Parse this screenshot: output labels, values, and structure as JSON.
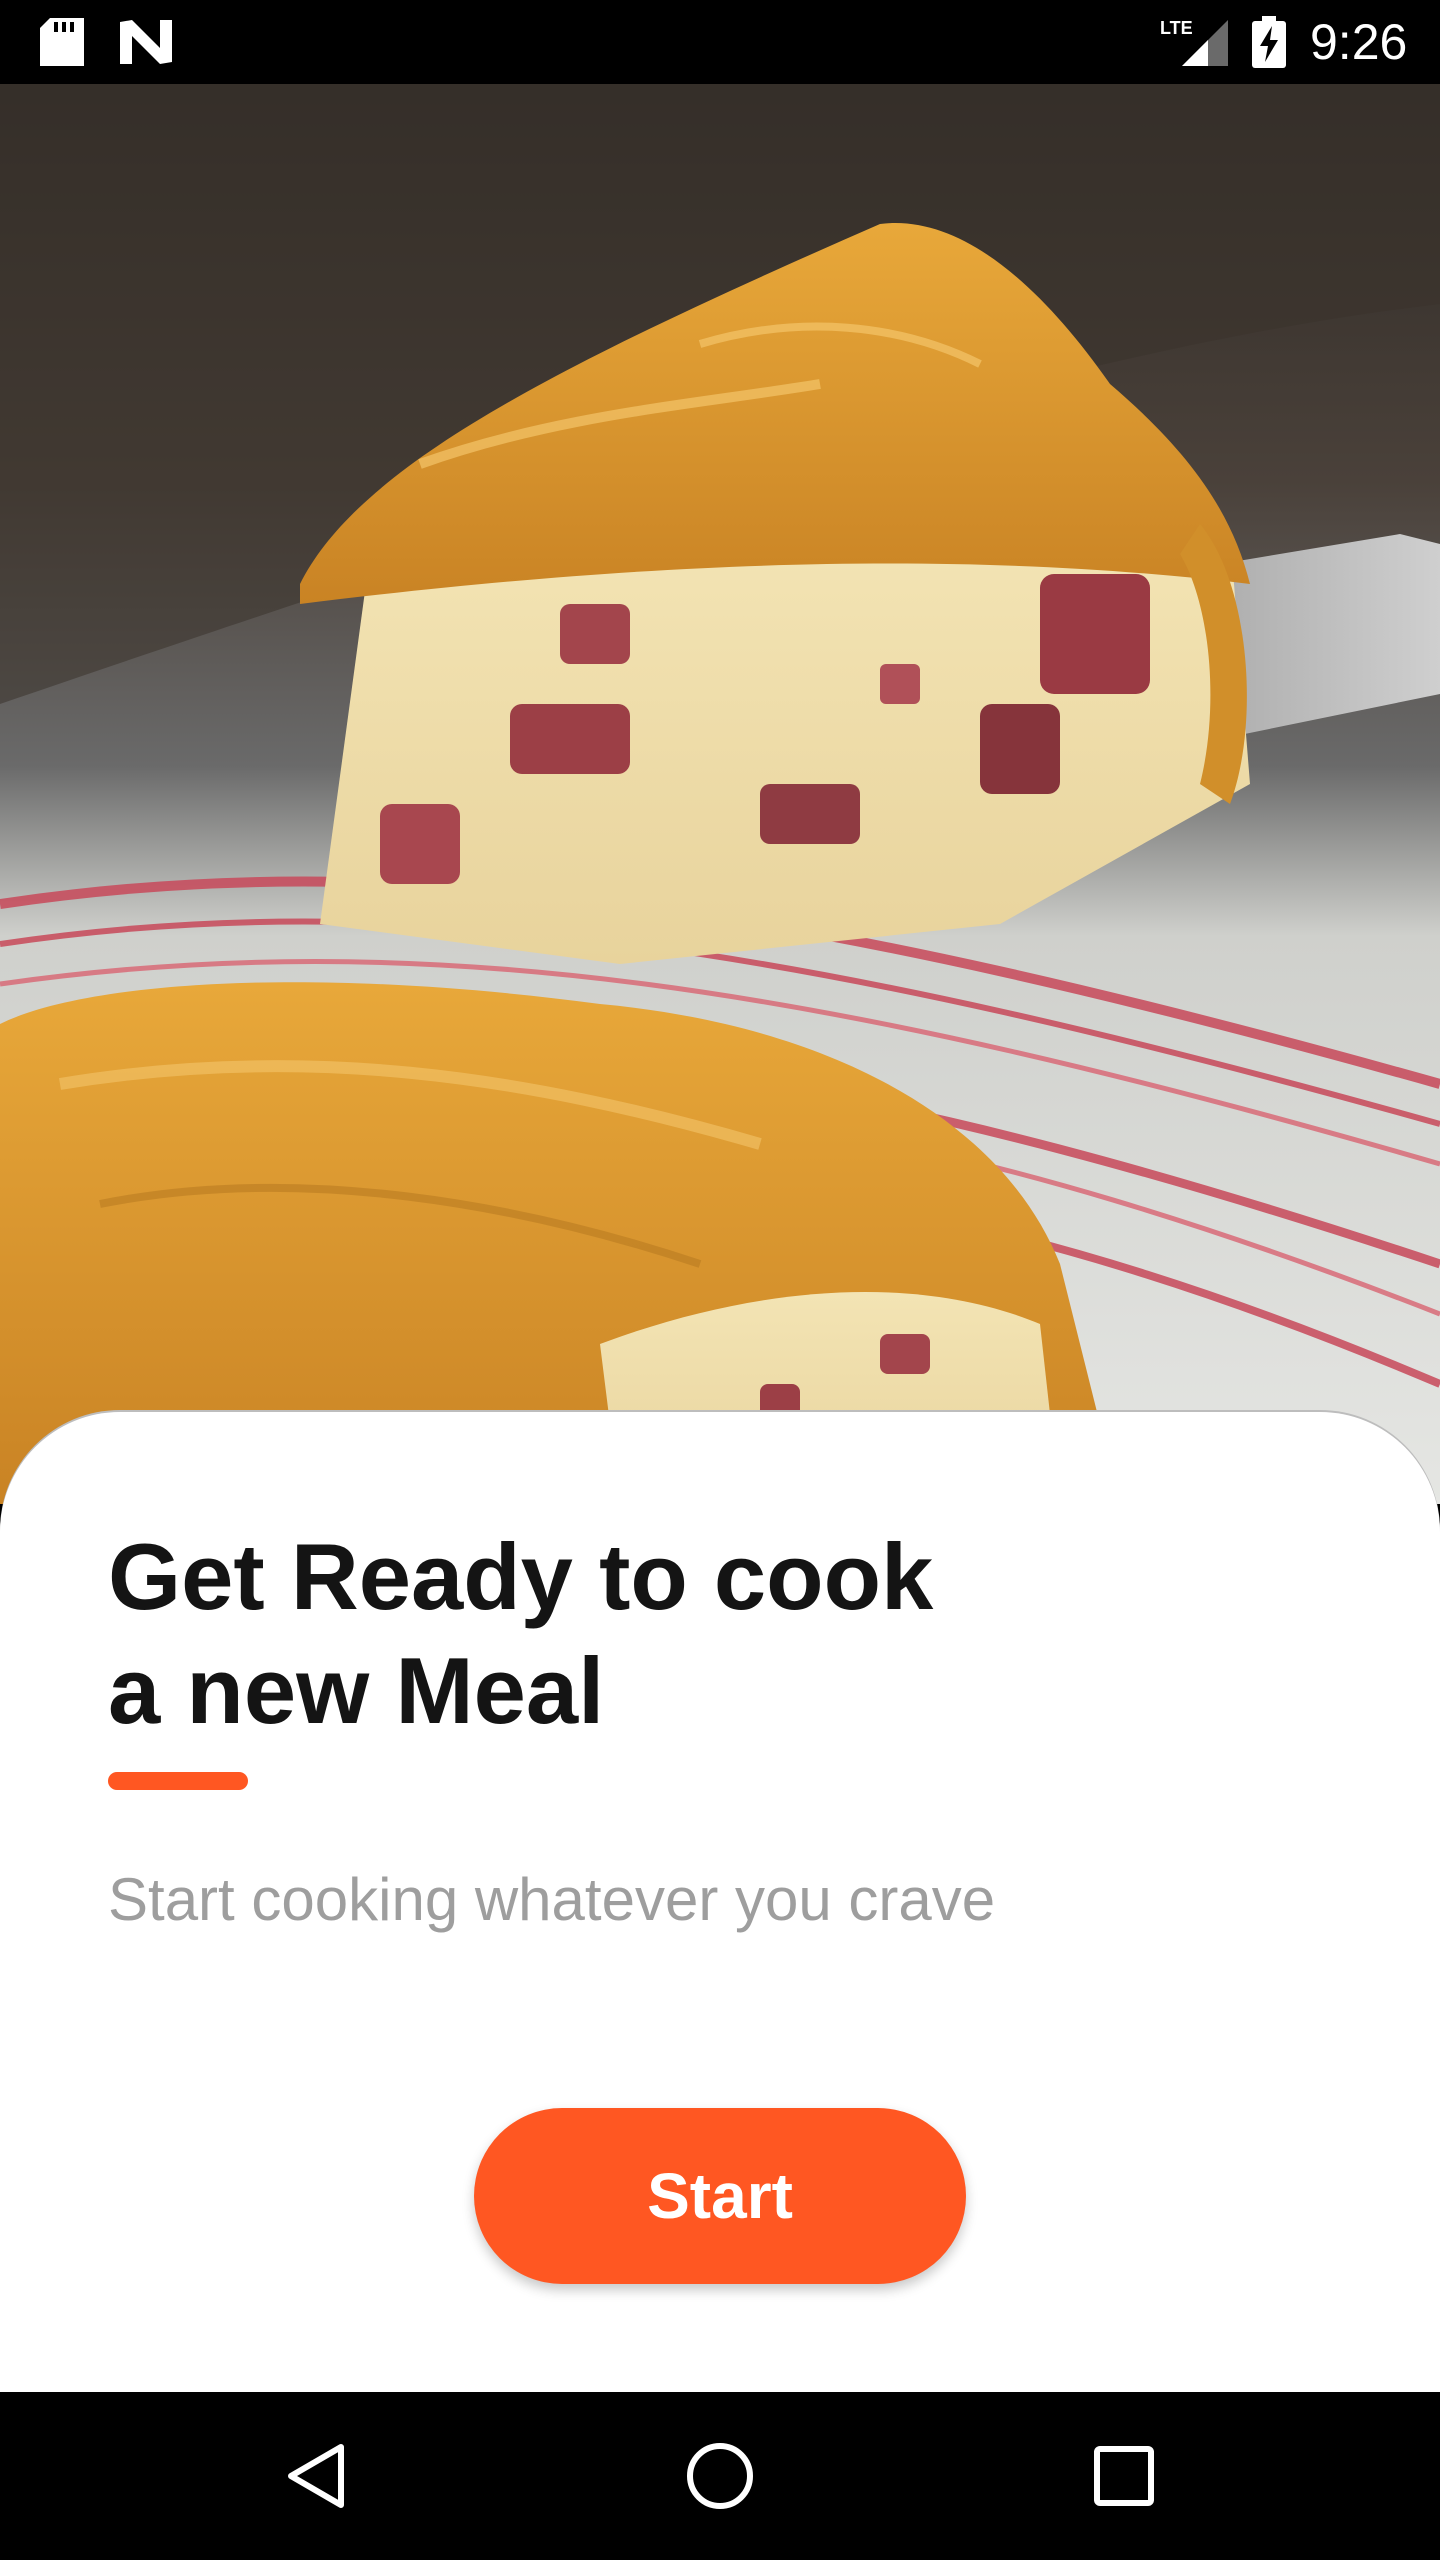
{
  "status_bar": {
    "network_label": "LTE",
    "time": "9:26"
  },
  "hero": {
    "icon": "food-photo-savory-pie-slice"
  },
  "card": {
    "title_line1": "Get Ready to cook",
    "title_line2": "a new Meal",
    "subtitle": "Start cooking whatever you crave",
    "start_label": "Start"
  },
  "navigation": {
    "back_icon": "back-triangle-icon",
    "home_icon": "home-circle-icon",
    "recents_icon": "recents-square-icon"
  },
  "colors": {
    "accent": "#ff5722",
    "title": "#141414",
    "subtitle": "#9e9e9e",
    "bars": "#000000"
  }
}
